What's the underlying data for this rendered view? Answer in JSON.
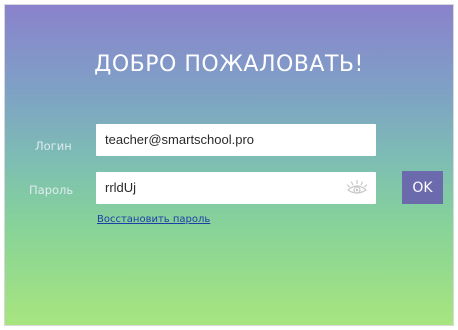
{
  "title": "ДОБРО ПОЖАЛОВАТЬ!",
  "form": {
    "login_label": "Логин",
    "login_value": "teacher@smartschool.pro",
    "password_label": "Пароль",
    "password_value": "rrldUj",
    "show_password_icon": "eye-icon",
    "ok_label": "OK",
    "restore_link": "Восстановить пароль"
  },
  "colors": {
    "gradient_top": "#8a82cc",
    "gradient_bottom": "#a7e57e",
    "ok_button": "#6a6aad",
    "link": "#1f3da8"
  }
}
